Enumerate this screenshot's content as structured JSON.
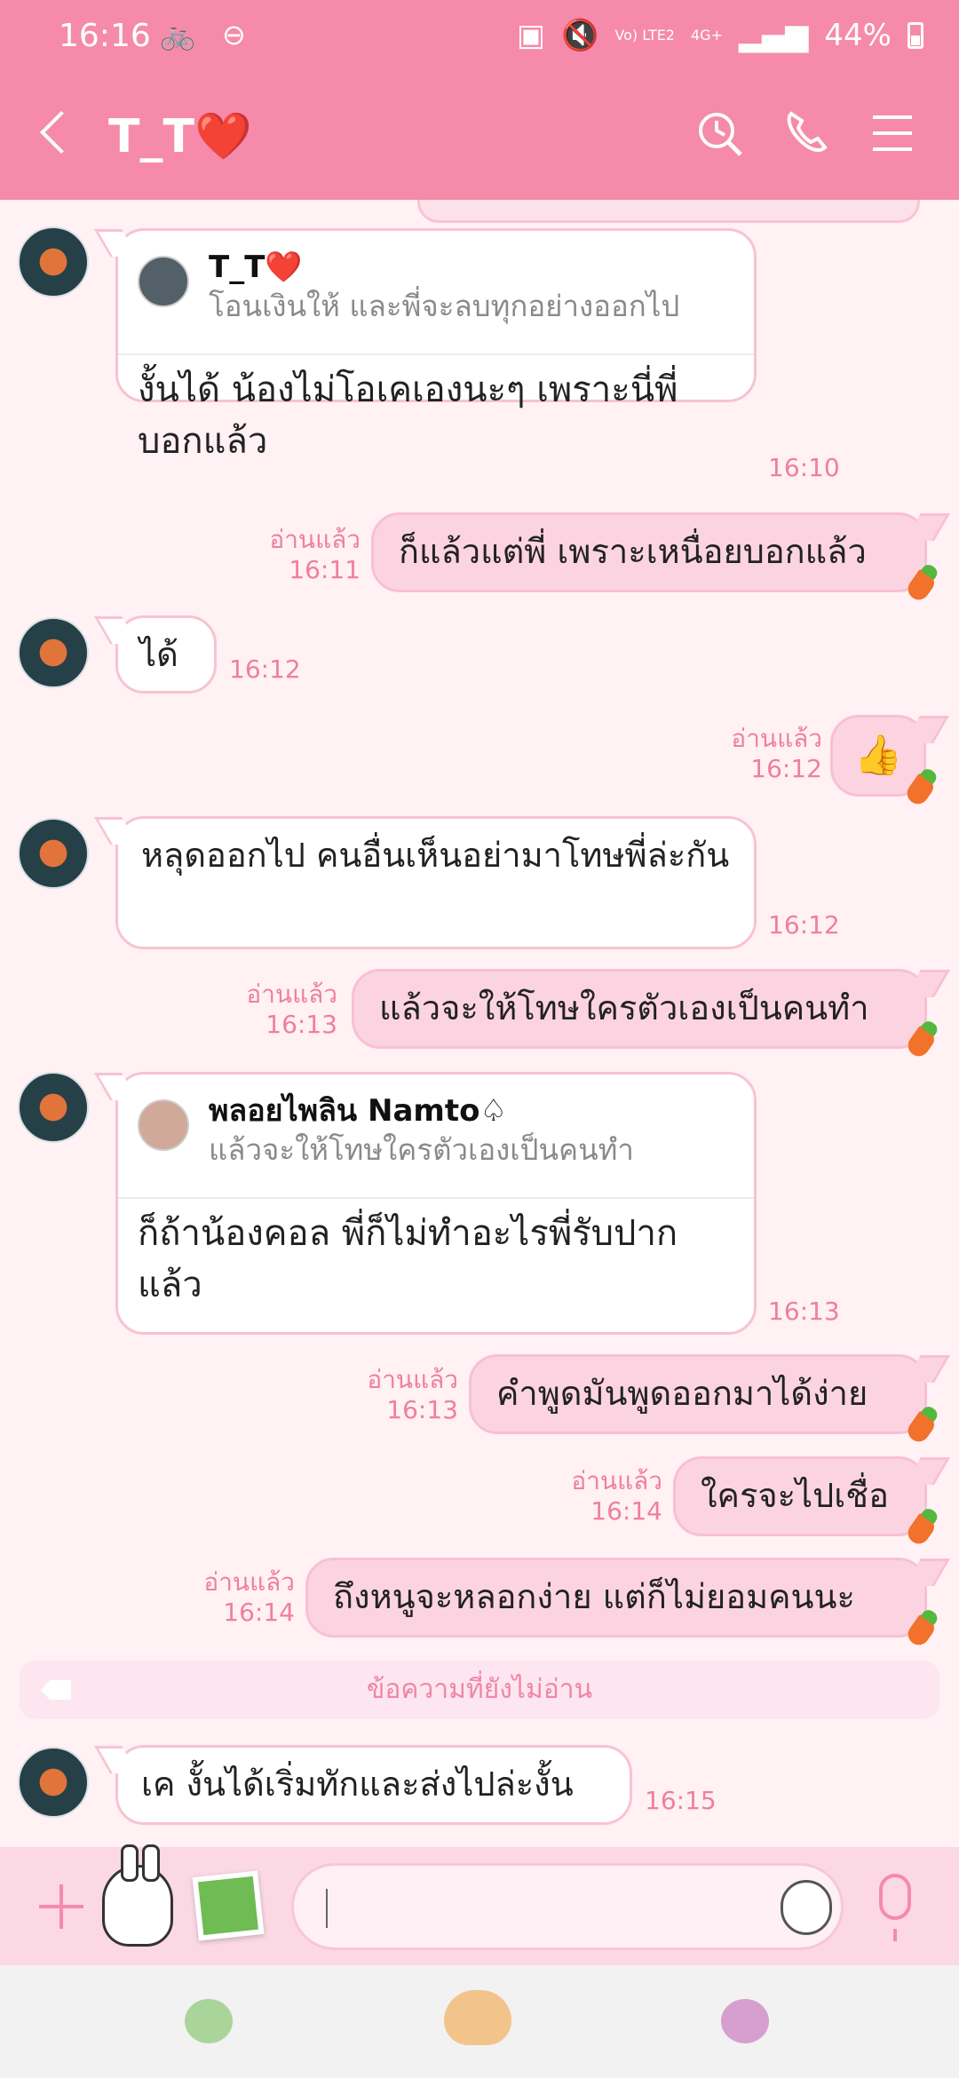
{
  "status_bar": {
    "time": "16:16",
    "left_icons": [
      "bike-icon",
      "minus-circle-icon"
    ],
    "network": "Vo) LTE2",
    "network_type": "4G+",
    "battery": "44%"
  },
  "header": {
    "title": "T_T❤️",
    "icons": [
      "back-icon",
      "search-icon",
      "phone-icon",
      "menu-icon"
    ]
  },
  "messages": [
    {
      "reply_to": {
        "name": "T_T❤️",
        "text": "โอนเงินให้ และพี่จะลบทุกอย่างออกไป"
      },
      "text": "งั้นได้ น้องไม่โอเคเองนะๆ เพราะนี่พี่บอกแล้ว",
      "time": "16:10"
    },
    {
      "read": "อ่านแล้ว",
      "time": "16:11",
      "text": "ก็แล้วแต่พี่ เพราะเหนื่อยบอกแล้ว"
    },
    {
      "text": "ได้",
      "time": "16:12"
    },
    {
      "read": "อ่านแล้ว",
      "time": "16:12",
      "text": "👍"
    },
    {
      "text": "หลุดออกไป คนอื่นเห็นอย่ามาโทษพี่ล่ะกัน",
      "time": "16:12"
    },
    {
      "read": "อ่านแล้ว",
      "time": "16:13",
      "text": "แล้วจะให้โทษใครตัวเองเป็นคนทำ"
    },
    {
      "reply_to": {
        "name": "พลอยไพลิน Namto♤",
        "text": "แล้วจะให้โทษใครตัวเองเป็นคนทำ"
      },
      "text": "ก็ถ้าน้องคอล พี่ก็ไม่ทำอะไรพี่รับปากแล้ว",
      "time": "16:13"
    },
    {
      "read": "อ่านแล้ว",
      "time": "16:13",
      "text": "คำพูดมันพูดออกมาได้ง่าย"
    },
    {
      "read": "อ่านแล้ว",
      "time": "16:14",
      "text": "ใครจะไปเชื่อ"
    },
    {
      "read": "อ่านแล้ว",
      "time": "16:14",
      "text": "ถึงหนูจะหลอกง่าย แต่ก็ไม่ยอมคนนะ"
    },
    {
      "text": "เค งั้นได้เริ่มทักและส่งไปล่ะงั้น",
      "time": "16:15"
    }
  ],
  "unread_label": "ข้อความที่ยังไม่อ่าน",
  "composer": {
    "input_placeholder": "",
    "icons": [
      "plus-icon",
      "sticker-icon",
      "photo-icon",
      "emoji-icon",
      "microphone-icon"
    ]
  },
  "bottom_nav": [
    "green-bean-icon",
    "bear-icon",
    "purple-bean-icon"
  ],
  "colors": {
    "header": "#f58aab",
    "background": "#fff1f4",
    "outgoing_bubble": "#fcd4e1",
    "accent": "#ef7ea2"
  }
}
